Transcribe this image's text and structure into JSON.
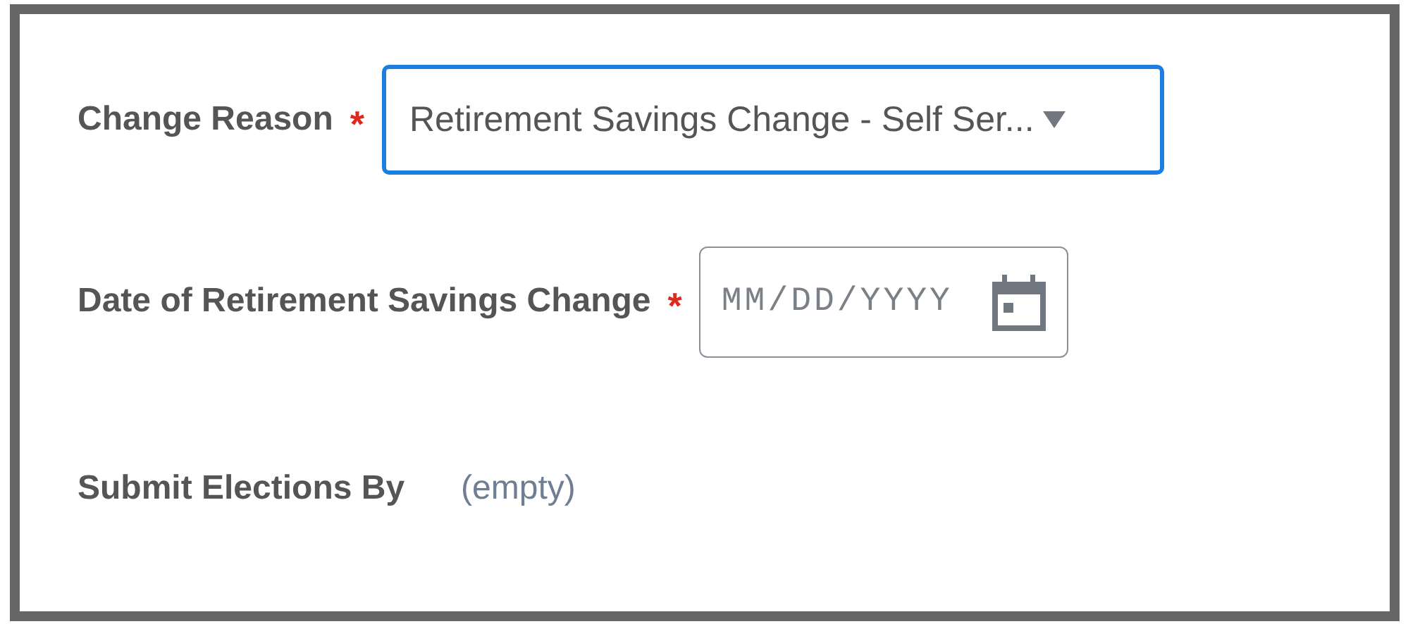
{
  "fields": [
    {
      "kind": "select",
      "label": "Change Reason",
      "required_mark": "*",
      "focused": true,
      "value": "Retirement Savings Change - Self Ser..."
    },
    {
      "kind": "date",
      "label": "Date of Retirement Savings Change",
      "required_mark": "*",
      "focused": false,
      "placeholder": "MM/DD/YYYY"
    },
    {
      "kind": "readonly",
      "label": "Submit Elections By",
      "value": "(empty)"
    }
  ]
}
